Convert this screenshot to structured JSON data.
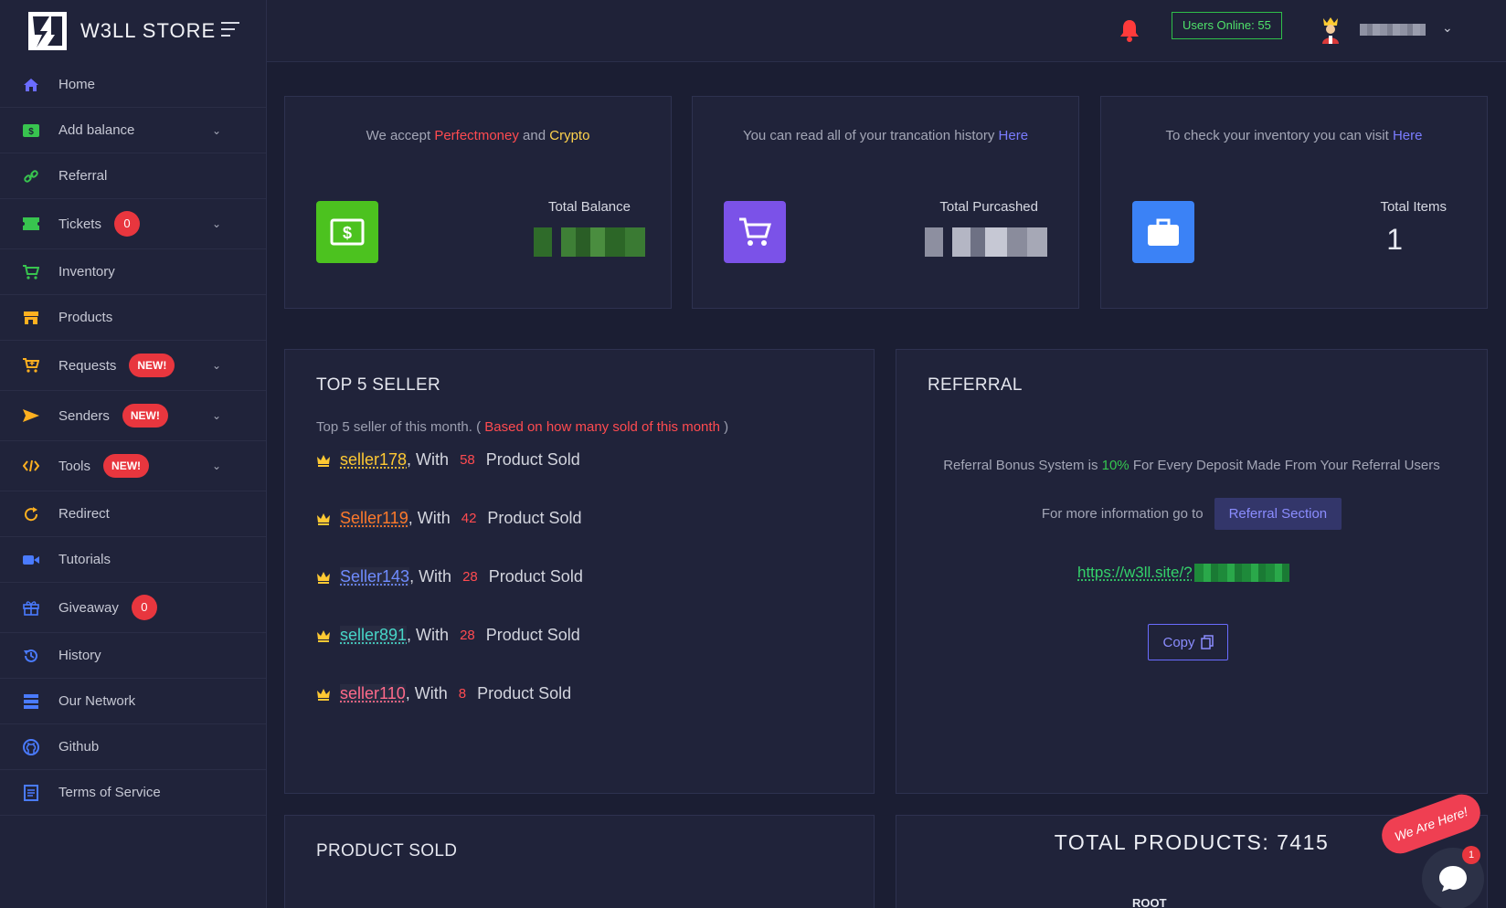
{
  "brand": {
    "name": "W3LL STORE"
  },
  "header": {
    "users_online": "Users Online: 55"
  },
  "sidebar": {
    "items": [
      {
        "label": "Home"
      },
      {
        "label": "Add balance"
      },
      {
        "label": "Referral"
      },
      {
        "label": "Tickets",
        "badge": "0"
      },
      {
        "label": "Inventory"
      },
      {
        "label": "Products"
      },
      {
        "label": "Requests",
        "badge": "NEW!"
      },
      {
        "label": "Senders",
        "badge": "NEW!"
      },
      {
        "label": "Tools",
        "badge": "NEW!"
      },
      {
        "label": "Redirect"
      },
      {
        "label": "Tutorials"
      },
      {
        "label": "Giveaway",
        "badge": "0"
      },
      {
        "label": "History"
      },
      {
        "label": "Our Network"
      },
      {
        "label": "Github"
      },
      {
        "label": "Terms of Service"
      }
    ]
  },
  "cards": {
    "balance": {
      "prefix": "We accept ",
      "pm": "Perfectmoney",
      "and": " and ",
      "crypto": "Crypto",
      "label": "Total Balance"
    },
    "purchased": {
      "prefix": "You can read all of your trancation history ",
      "link": "Here",
      "label": "Total Purcashed"
    },
    "items": {
      "prefix": "To check your inventory you can visit ",
      "link": "Here",
      "label": "Total Items",
      "value": "1"
    }
  },
  "top_sellers": {
    "title": "TOP 5 SELLER",
    "subtitle_prefix": "Top 5 seller of this month. (",
    "subtitle_highlight": "Based on how many sold of this month",
    "subtitle_suffix": ")",
    "with_label": ", With",
    "sold_label": "Product Sold",
    "rows": [
      {
        "name": "seller178",
        "count": "58",
        "color": "#ffc933"
      },
      {
        "name": "Seller119",
        "count": "42",
        "color": "#ff7a2b"
      },
      {
        "name": "Seller143",
        "count": "28",
        "color": "#6f8cff"
      },
      {
        "name": "seller891",
        "count": "28",
        "color": "#47d6c8"
      },
      {
        "name": "seller110",
        "count": "8",
        "color": "#ff6a8a"
      }
    ]
  },
  "referral": {
    "title": "REFERRAL",
    "bonus_prefix": "Referral Bonus System is ",
    "bonus_pct": "10%",
    "bonus_suffix": " For Every Deposit Made From Your Referral Users",
    "info_text": "For more information go to",
    "section_button": "Referral Section",
    "link": "https://w3ll.site/?",
    "copy_label": "Copy"
  },
  "product_sold": {
    "title": "PRODUCT SOLD"
  },
  "total_products": {
    "title": "TOTAL PRODUCTS: 7415",
    "root": "ROOT"
  },
  "chat": {
    "tag": "We Are Here!",
    "notif": "1"
  }
}
